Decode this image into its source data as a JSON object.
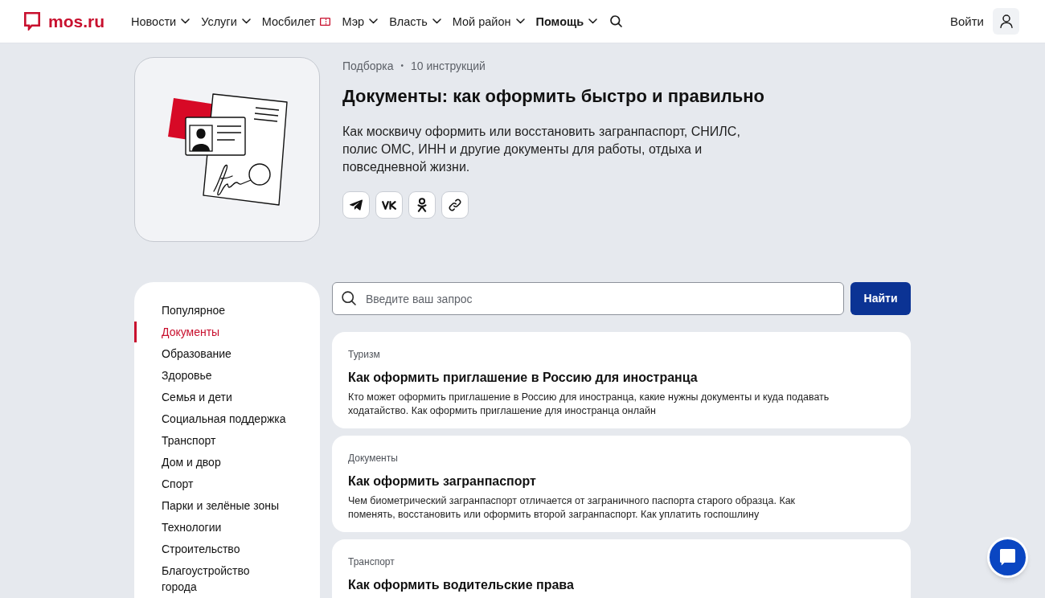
{
  "header": {
    "logo": {
      "text": "mos.ru"
    },
    "nav": [
      {
        "label": "Новости",
        "kind": "dropdown",
        "selected": false
      },
      {
        "label": "Услуги",
        "kind": "dropdown",
        "selected": false
      },
      {
        "label": "Мосбилет",
        "kind": "ticket",
        "selected": false
      },
      {
        "label": "Мэр",
        "kind": "dropdown",
        "selected": false
      },
      {
        "label": "Власть",
        "kind": "dropdown",
        "selected": false
      },
      {
        "label": "Мой район",
        "kind": "dropdown",
        "selected": false
      },
      {
        "label": "Помощь",
        "kind": "dropdown",
        "selected": true
      }
    ],
    "login": {
      "label": "Войти"
    }
  },
  "collection": {
    "meta": {
      "label": "Подборка",
      "separator": "•",
      "count": "10 инструкций"
    },
    "title": "Документы: как оформить быстро и правильно",
    "description": "Как москвичу оформить или восстановить загранпаспорт, СНИЛС, полис ОМС, ИНН и другие документы для работы, отдыха и повседневной жизни.",
    "share_buttons": [
      {
        "kind": "telegram"
      },
      {
        "kind": "vk"
      },
      {
        "kind": "ok"
      },
      {
        "kind": "link"
      }
    ]
  },
  "sidebar": {
    "items": [
      {
        "label": "Популярное",
        "selected": false
      },
      {
        "label": "Документы",
        "selected": true
      },
      {
        "label": "Образование",
        "selected": false
      },
      {
        "label": "Здоровье",
        "selected": false
      },
      {
        "label": "Семья и дети",
        "selected": false
      },
      {
        "label": "Социальная поддержка",
        "selected": false
      },
      {
        "label": "Транспорт",
        "selected": false
      },
      {
        "label": "Дом и двор",
        "selected": false
      },
      {
        "label": "Спорт",
        "selected": false
      },
      {
        "label": "Парки и зелёные зоны",
        "selected": false
      },
      {
        "label": "Технологии",
        "selected": false
      },
      {
        "label": "Строительство",
        "selected": false
      },
      {
        "label": "Благоустройство города",
        "selected": false
      }
    ]
  },
  "search": {
    "placeholder": "Введите ваш запрос",
    "button": "Найти"
  },
  "articles": [
    {
      "category": "Туризм",
      "title": "Как оформить приглашение в Россию для иностранца",
      "description": "Кто может оформить приглашение в Россию для иностранца, какие нужны документы и куда подавать ходатайство. Как оформить приглашение для иностранца онлайн"
    },
    {
      "category": "Документы",
      "title": "Как оформить загранпаспорт",
      "description": "Чем биометрический загранпаспорт отличается от заграничного паспорта старого образца. Как поменять, восстановить или оформить второй загранпаспорт. Как уплатить госпошлину"
    },
    {
      "category": "Транспорт",
      "title": "Как оформить водительские права"
    }
  ]
}
